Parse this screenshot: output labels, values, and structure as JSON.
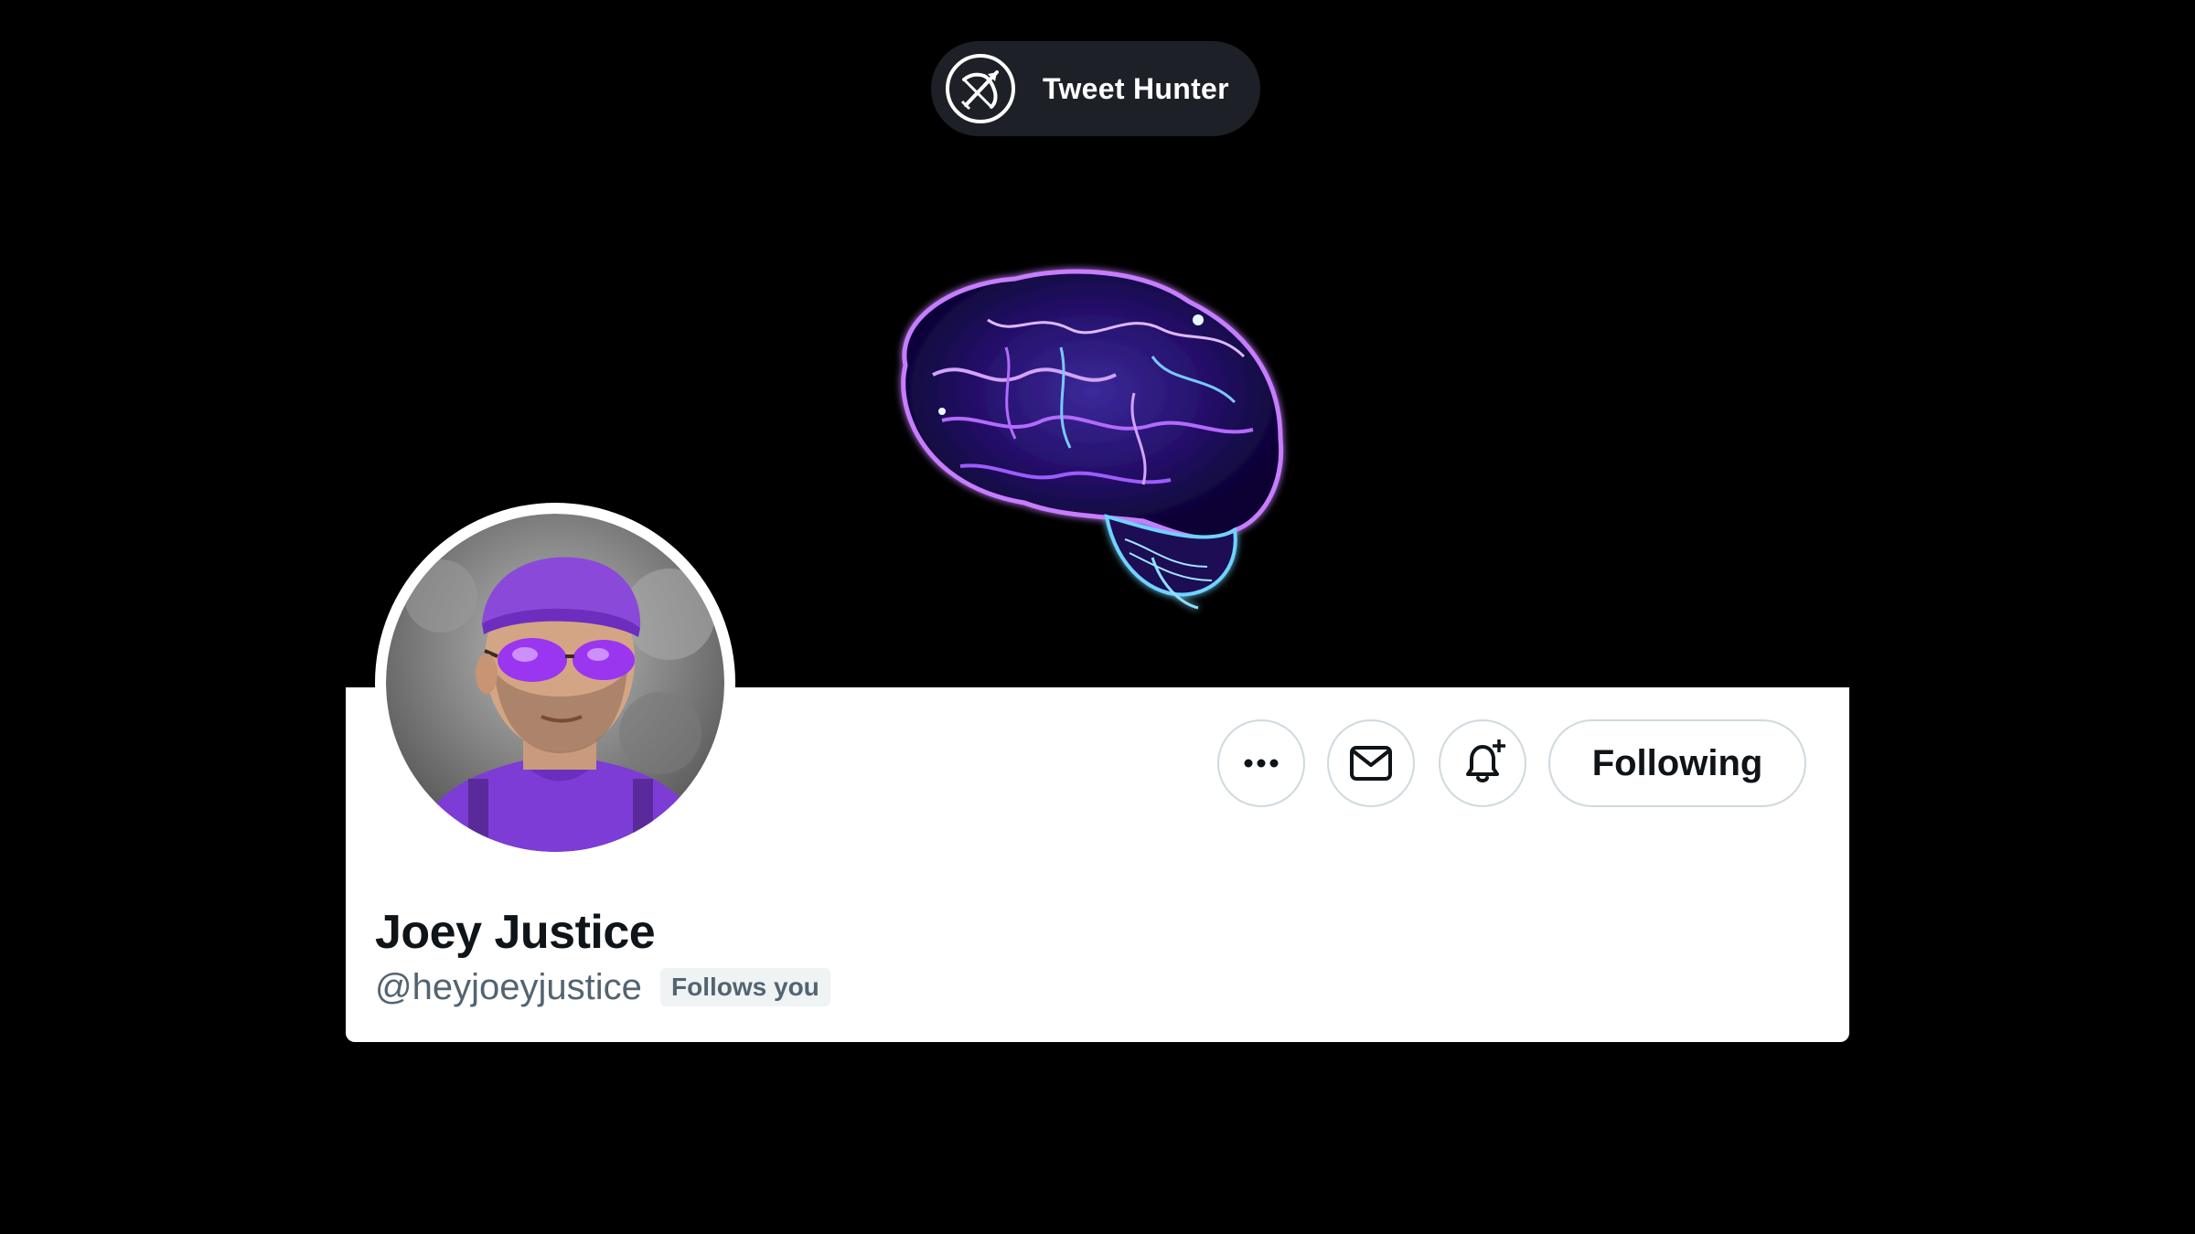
{
  "brand": {
    "name": "Tweet Hunter",
    "logo_icon": "bow-and-arrow-icon"
  },
  "banner": {
    "art": "glowing-brain-illustration",
    "background_color": "#000000"
  },
  "profile": {
    "display_name": "Joey Justice",
    "handle": "@heyjoeyjustice",
    "follows_you_badge": "Follows you",
    "avatar": "user-avatar-photo"
  },
  "actions": {
    "more_icon": "more-options-icon",
    "message_icon": "envelope-icon",
    "notify_icon": "bell-plus-icon",
    "following_label": "Following"
  },
  "colors": {
    "text_primary": "#0f1419",
    "text_secondary": "#536471",
    "border": "#cfd9de",
    "accent_purple": "#8a2be2"
  }
}
